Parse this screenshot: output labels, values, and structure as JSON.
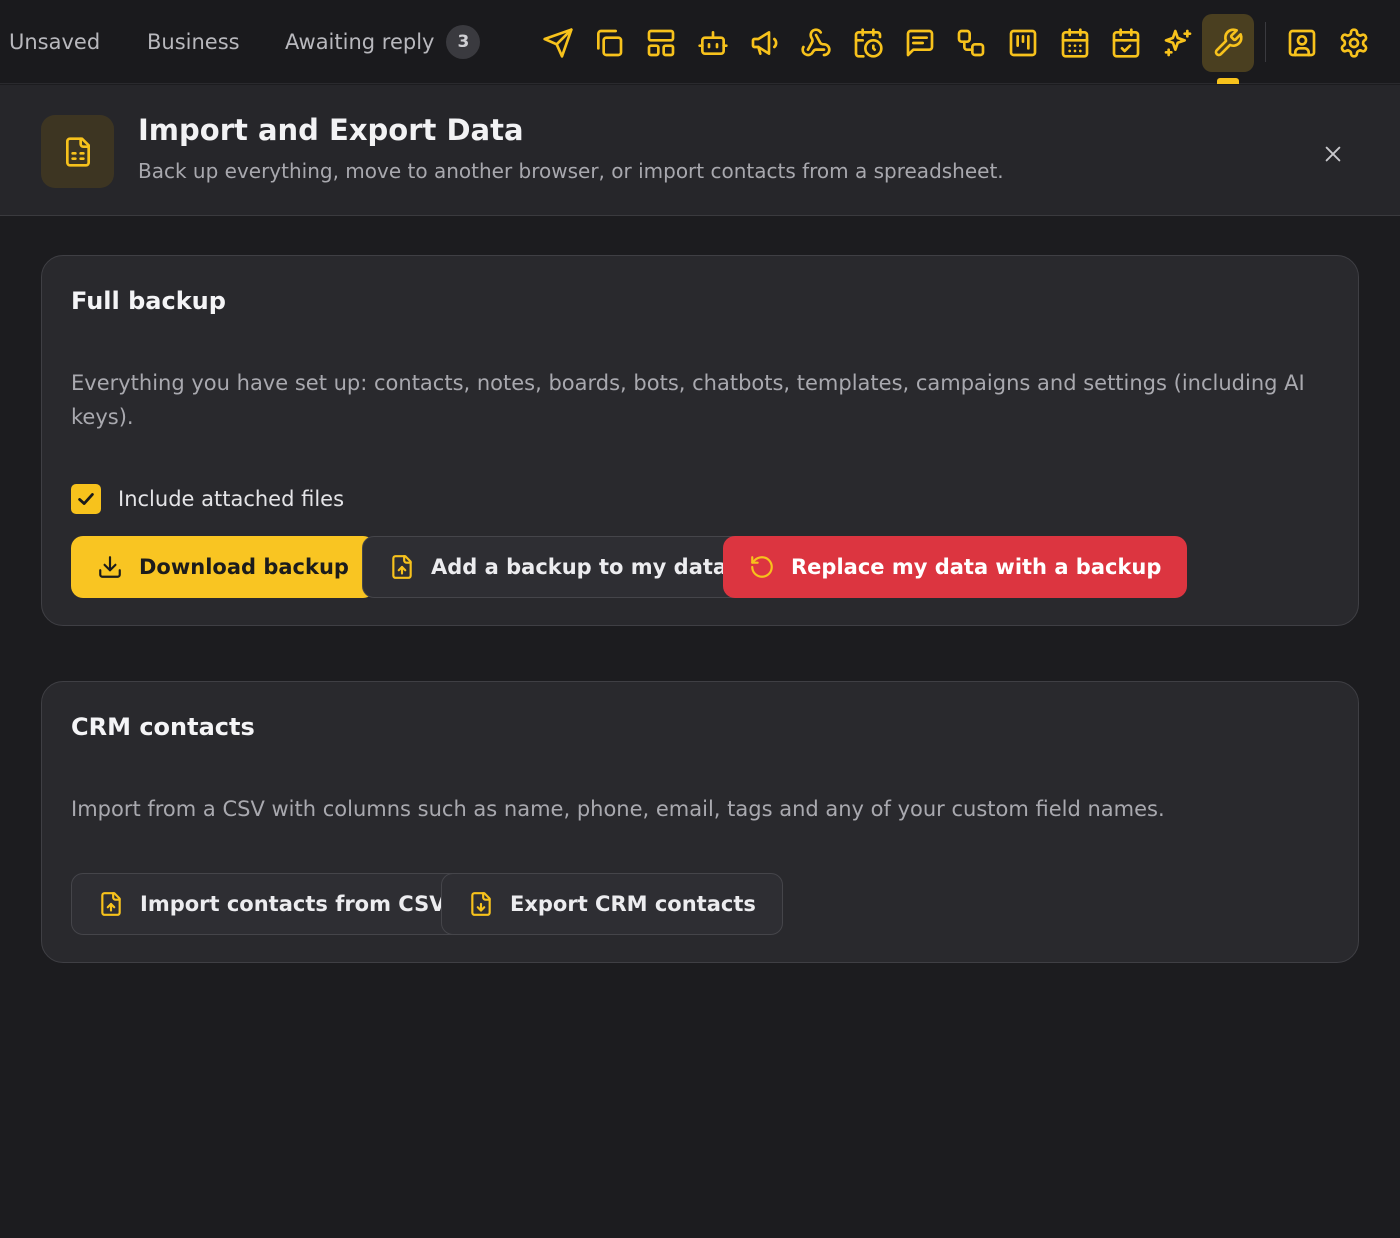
{
  "topbar": {
    "tabs": [
      {
        "label": "Unsaved"
      },
      {
        "label": "Business"
      },
      {
        "label": "Awaiting reply",
        "badge": "3"
      }
    ],
    "tool_icons": [
      "send-icon",
      "copy-icon",
      "layout-icon",
      "bot-icon",
      "megaphone-icon",
      "webhook-icon",
      "calendar-clock-icon",
      "message-square-icon",
      "workflow-icon",
      "kanban-icon",
      "calendar-grid-icon",
      "calendar-check-icon",
      "sparkles-icon",
      "wrench-icon",
      "contact-icon",
      "settings-icon"
    ],
    "active_tool": "wrench-icon"
  },
  "header": {
    "title": "Import and Export Data",
    "subtitle": "Back up everything, move to another browser, or import contacts from a spreadsheet."
  },
  "backup": {
    "title": "Full backup",
    "description": "Everything you have set up: contacts, notes, boards, bots, chatbots, templates, campaigns and settings (including AI keys).",
    "include_files_label": "Include attached files",
    "include_files_checked": true,
    "download_label": "Download backup",
    "add_label": "Add a backup to my data",
    "replace_label": "Replace my data with a backup"
  },
  "crm": {
    "title": "CRM contacts",
    "description": "Import from a CSV with columns such as name, phone, email, tags and any of your custom field names.",
    "import_label": "Import contacts from CSV",
    "export_label": "Export CRM contacts"
  },
  "colors": {
    "accent": "#f7c21c",
    "danger": "#dc3540",
    "background": "#1c1c1f"
  }
}
